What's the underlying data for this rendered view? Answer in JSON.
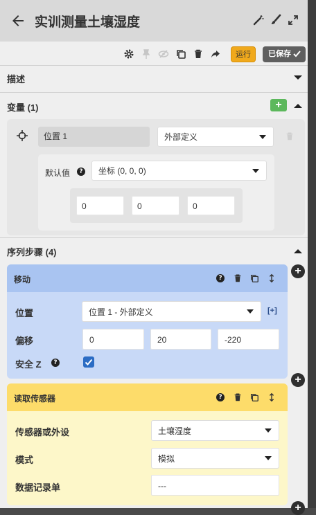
{
  "window": {
    "title": "实训测量土壤湿度"
  },
  "header_icons": [
    "magic-wand-icon",
    "brush-icon",
    "expand-icon"
  ],
  "toolbar": {
    "icons": [
      "gear-icon",
      "pin-icon",
      "eye-slash-icon",
      "copy-icon",
      "trash-icon",
      "share-icon"
    ],
    "run_label": "运行",
    "saved_label": "已保存",
    "colors": {
      "run": "#f0a91c",
      "saved": "#5f5f5f"
    }
  },
  "sections": {
    "description": "描述",
    "variables": "变量 (1)",
    "steps": "序列步骤 (4)"
  },
  "variable": {
    "name": "位置 1",
    "type": "外部定义",
    "default_label": "默认值",
    "default_value": "坐标 (0, 0, 0)",
    "coords": [
      "0",
      "0",
      "0"
    ]
  },
  "steps": [
    {
      "title": "移动",
      "color": "#a9c4f1",
      "fields": {
        "position_label": "位置",
        "position_value": "位置 1 - 外部定义",
        "add_link": "[+]",
        "offset_label": "偏移",
        "offset": [
          "0",
          "20",
          "-220"
        ],
        "safe_z_label": "安全 Z",
        "safe_z_checked": true
      }
    },
    {
      "title": "读取传感器",
      "color": "#fddc6a",
      "fields": {
        "sensor_label": "传感器或外设",
        "sensor_value": "土壤湿度",
        "mode_label": "模式",
        "mode_value": "模拟",
        "datatable_label": "数据记录单",
        "datatable_value": "---"
      }
    }
  ]
}
